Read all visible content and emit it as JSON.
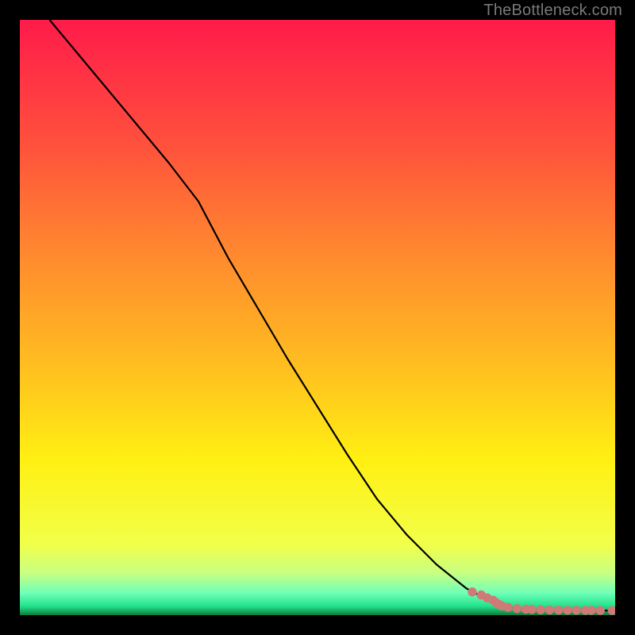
{
  "watermark": "TheBottleneck.com",
  "colors": {
    "background": "#000000",
    "line": "#000000",
    "marker_fill": "#cf7a77",
    "marker_stroke": "#cf7a77",
    "gradient_stops": [
      {
        "offset": 0.0,
        "color": "#ff1b4a"
      },
      {
        "offset": 0.2,
        "color": "#ff4e3d"
      },
      {
        "offset": 0.4,
        "color": "#ff8b2e"
      },
      {
        "offset": 0.58,
        "color": "#ffbe20"
      },
      {
        "offset": 0.74,
        "color": "#fff012"
      },
      {
        "offset": 0.88,
        "color": "#f2ff49"
      },
      {
        "offset": 0.93,
        "color": "#c7ff82"
      },
      {
        "offset": 0.963,
        "color": "#6fffb8"
      },
      {
        "offset": 0.985,
        "color": "#22e28c"
      },
      {
        "offset": 1.0,
        "color": "#0e7b3d"
      }
    ]
  },
  "chart_data": {
    "type": "line",
    "title": "",
    "xlabel": "",
    "ylabel": "",
    "xlim": [
      0,
      100
    ],
    "ylim": [
      0,
      100
    ],
    "grid": false,
    "legend": false,
    "series": [
      {
        "name": "curve",
        "style": "line",
        "x": [
          5,
          10,
          15,
          20,
          25,
          30,
          35,
          40,
          45,
          50,
          55,
          60,
          65,
          70,
          75,
          80,
          81,
          82,
          84,
          86,
          88,
          90,
          93,
          96,
          100
        ],
        "y": [
          100,
          94,
          88,
          82,
          76,
          69.5,
          60,
          51.5,
          43,
          35,
          27,
          19.5,
          13.5,
          8.5,
          4.5,
          1.8,
          1.5,
          1.3,
          1.1,
          1.0,
          0.9,
          0.85,
          0.8,
          0.78,
          0.75
        ]
      },
      {
        "name": "points",
        "style": "scatter",
        "x": [
          76,
          77.5,
          78.5,
          79.5,
          80,
          80.5,
          81,
          82,
          83.5,
          85,
          86,
          87.5,
          89,
          90.5,
          92,
          93.5,
          95,
          96,
          97.5,
          99.5
        ],
        "y": [
          3.9,
          3.4,
          2.9,
          2.5,
          2.1,
          1.8,
          1.55,
          1.3,
          1.1,
          1.0,
          0.95,
          0.9,
          0.87,
          0.85,
          0.83,
          0.82,
          0.81,
          0.8,
          0.79,
          0.78
        ]
      }
    ]
  }
}
